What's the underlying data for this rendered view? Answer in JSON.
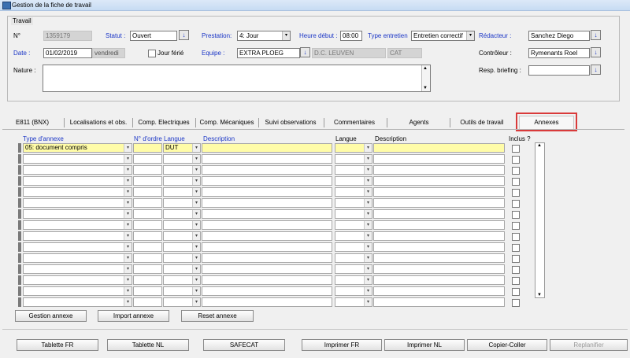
{
  "window": {
    "title": "Gestion de la fiche de travail"
  },
  "travail": {
    "group_label": "Travail",
    "no_label": "N°",
    "no_value": "1359179",
    "statut_label": "Statut :",
    "statut_value": "Ouvert",
    "prestation_label": "Prestation:",
    "prestation_value": "4: Jour",
    "heure_label": "Heure début :",
    "heure_value": "08:00",
    "type_entretien_label": "Type entretien",
    "type_entretien_value": "Entretien correctif",
    "redacteur_label": "Rédacteur :",
    "redacteur_value": "Sanchez Diego",
    "date_label": "Date :",
    "date_value": "01/02/2019",
    "day_value": "vendredi",
    "jour_ferie_label": "Jour férié",
    "equipe_label": "Equipe :",
    "equipe_value": "EXTRA PLOEG",
    "dc_value": "D.C. LEUVEN",
    "cat_value": "CAT",
    "controleur_label": "Contrôleur :",
    "controleur_value": "Rymenants Roel",
    "nature_label": "Nature :",
    "nature_value": "",
    "resp_label": "Resp. briefing :",
    "resp_value": ""
  },
  "tabs": [
    {
      "label": "E811 (BNX)"
    },
    {
      "label": "Localisations et obs."
    },
    {
      "label": "Comp. Electriques"
    },
    {
      "label": "Comp. Mécaniques"
    },
    {
      "label": "Suivi observations"
    },
    {
      "label": "Commentaires"
    },
    {
      "label": "Agents"
    },
    {
      "label": "Outils de travail"
    },
    {
      "label": "Annexes"
    }
  ],
  "annex_table": {
    "headers": {
      "type": "Type d'annexe",
      "ordre": "N° d'ordre",
      "langue1": "Langue",
      "description1": "Description",
      "langue2": "Langue",
      "description2": "Description",
      "inclus": "Inclus ?"
    },
    "rows": [
      {
        "type": "05: document compris",
        "ordre": "",
        "langue": "DUT",
        "description": "",
        "langue2": "",
        "description2": ""
      },
      {
        "type": "",
        "ordre": "",
        "langue": "",
        "description": "",
        "langue2": "",
        "description2": ""
      },
      {
        "type": "",
        "ordre": "",
        "langue": "",
        "description": "",
        "langue2": "",
        "description2": ""
      },
      {
        "type": "",
        "ordre": "",
        "langue": "",
        "description": "",
        "langue2": "",
        "description2": ""
      },
      {
        "type": "",
        "ordre": "",
        "langue": "",
        "description": "",
        "langue2": "",
        "description2": ""
      },
      {
        "type": "",
        "ordre": "",
        "langue": "",
        "description": "",
        "langue2": "",
        "description2": ""
      },
      {
        "type": "",
        "ordre": "",
        "langue": "",
        "description": "",
        "langue2": "",
        "description2": ""
      },
      {
        "type": "",
        "ordre": "",
        "langue": "",
        "description": "",
        "langue2": "",
        "description2": ""
      },
      {
        "type": "",
        "ordre": "",
        "langue": "",
        "description": "",
        "langue2": "",
        "description2": ""
      },
      {
        "type": "",
        "ordre": "",
        "langue": "",
        "description": "",
        "langue2": "",
        "description2": ""
      },
      {
        "type": "",
        "ordre": "",
        "langue": "",
        "description": "",
        "langue2": "",
        "description2": ""
      },
      {
        "type": "",
        "ordre": "",
        "langue": "",
        "description": "",
        "langue2": "",
        "description2": ""
      },
      {
        "type": "",
        "ordre": "",
        "langue": "",
        "description": "",
        "langue2": "",
        "description2": ""
      },
      {
        "type": "",
        "ordre": "",
        "langue": "",
        "description": "",
        "langue2": "",
        "description2": ""
      },
      {
        "type": "",
        "ordre": "",
        "langue": "",
        "description": "",
        "langue2": "",
        "description2": ""
      }
    ]
  },
  "annex_buttons": {
    "gestion": "Gestion annexe",
    "import": "Import annexe",
    "reset": "Reset annexe"
  },
  "footer_buttons": {
    "tablette_fr": "Tablette FR",
    "tablette_nl": "Tablette NL",
    "safecat": "SAFECAT",
    "imprimer_fr": "Imprimer FR",
    "imprimer_nl": "Imprimer NL",
    "copier_coller": "Copier-Coller",
    "replanifier": "Replanifier"
  },
  "icons": {
    "download": "↓",
    "dropdown": "▾",
    "up": "▲",
    "down": "▼"
  }
}
